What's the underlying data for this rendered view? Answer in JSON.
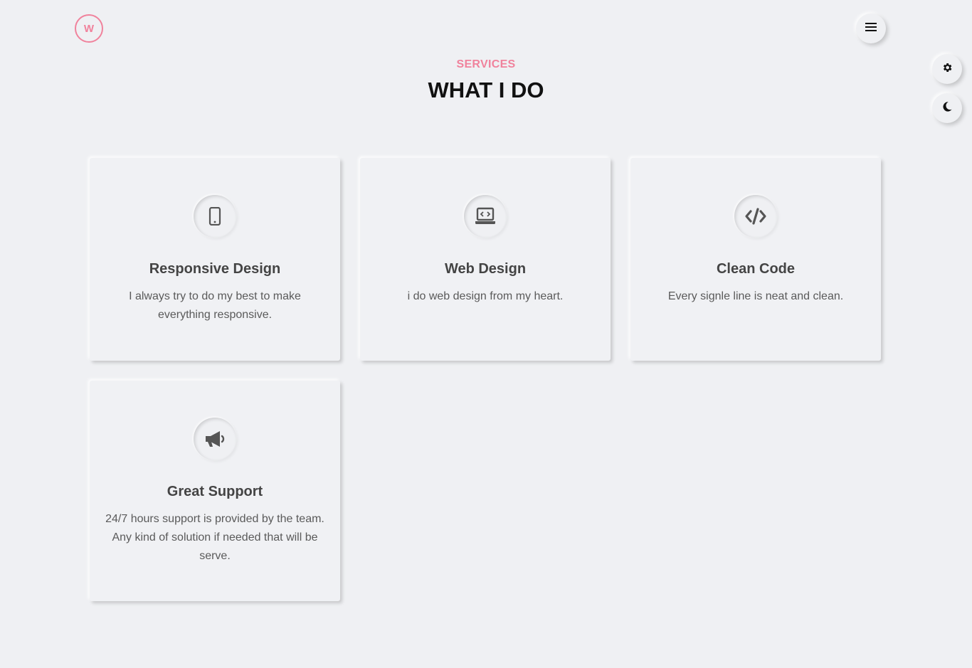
{
  "header": {
    "logo_letter": "W"
  },
  "section": {
    "tag": "SERVICES",
    "title": "WHAT I DO"
  },
  "controls": {
    "menu_icon": "hamburger-icon",
    "settings_icon": "gear-icon",
    "theme_icon": "moon-icon"
  },
  "colors": {
    "accent": "#f0829c",
    "background": "#eff0f3",
    "icon": "#555555"
  },
  "services": [
    {
      "title": "Responsive Design",
      "description": "I always try to do my best to make everything responsive.",
      "icon": "mobile-icon"
    },
    {
      "title": "Web Design",
      "description": "i do web design from my heart.",
      "icon": "laptop-code-icon"
    },
    {
      "title": "Clean Code",
      "description": "Every signle line is neat and clean.",
      "icon": "code-icon"
    },
    {
      "title": "Great Support",
      "description": "24/7 hours support is provided by the team. Any kind of solution if needed that will be serve.",
      "icon": "megaphone-icon"
    }
  ]
}
